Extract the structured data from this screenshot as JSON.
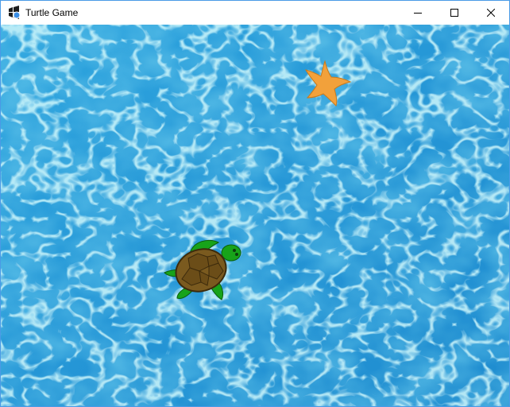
{
  "window": {
    "title": "Turtle Game",
    "app_icon": "windows-app-icon",
    "controls": {
      "minimize_icon": "minimize-icon",
      "maximize_icon": "maximize-icon",
      "close_icon": "close-icon"
    }
  },
  "game": {
    "background": "water-texture",
    "sprites": [
      {
        "name": "starfish",
        "color": "#f2a13b"
      },
      {
        "name": "turtle",
        "shell_color": "#7a5a1f",
        "skin_color": "#17a31a"
      }
    ],
    "colors": {
      "water_base": "#2a9fdb",
      "water_dark": "#1a7fc4",
      "water_light": "#8fe0f0"
    }
  }
}
